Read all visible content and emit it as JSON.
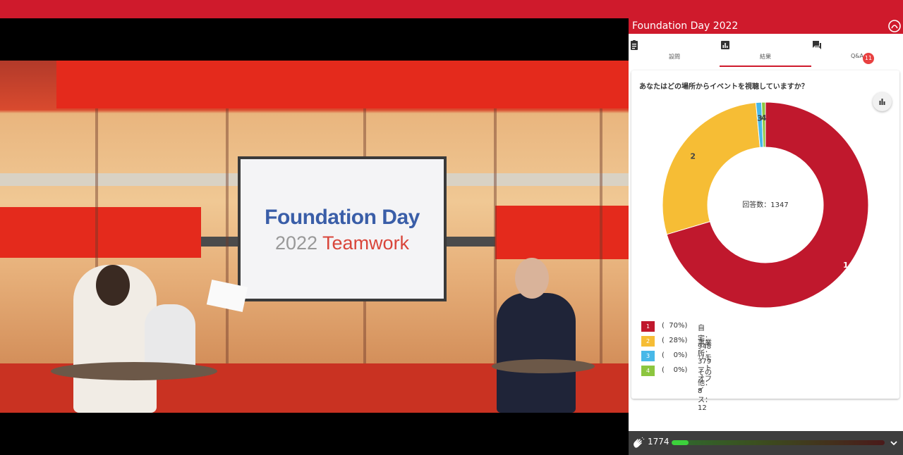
{
  "panel": {
    "title": "Foundation Day 2022",
    "tabs": [
      {
        "label": "設問",
        "icon": "clipboard-icon"
      },
      {
        "label": "結果",
        "icon": "bar-chart-icon"
      },
      {
        "label": "Q&A",
        "icon": "chat-icon"
      }
    ],
    "qa_badge": "11"
  },
  "video": {
    "screen_line1": "Foundation Day",
    "screen_line2a": "2022",
    "screen_line2b": "Teamwork"
  },
  "poll": {
    "question": "あなたはどの場所からイベントを視聴していますか？",
    "center_text": "回答数：1347",
    "options": [
      {
        "num": "1",
        "pct": "(  70%)",
        "label": "自宅：948",
        "color": "#c0182d"
      },
      {
        "num": "2",
        "pct": "(  28%)",
        "label": "事業所：379",
        "color": "#f6bd35"
      },
      {
        "num": "3",
        "pct": "(    0%)",
        "label": "リモートオフィス：12",
        "color": "#48b8e8"
      },
      {
        "num": "4",
        "pct": "(    0%)",
        "label": "その他：8",
        "color": "#8cc63f"
      }
    ]
  },
  "chart_data": {
    "type": "pie",
    "categories": [
      "1",
      "2",
      "3",
      "4"
    ],
    "values": [
      948,
      379,
      12,
      8
    ],
    "colors": [
      "#c0182d",
      "#f6bd35",
      "#48b8e8",
      "#8cc63f"
    ],
    "title": ""
  },
  "footer": {
    "count": "1774",
    "progress": 0.08
  }
}
